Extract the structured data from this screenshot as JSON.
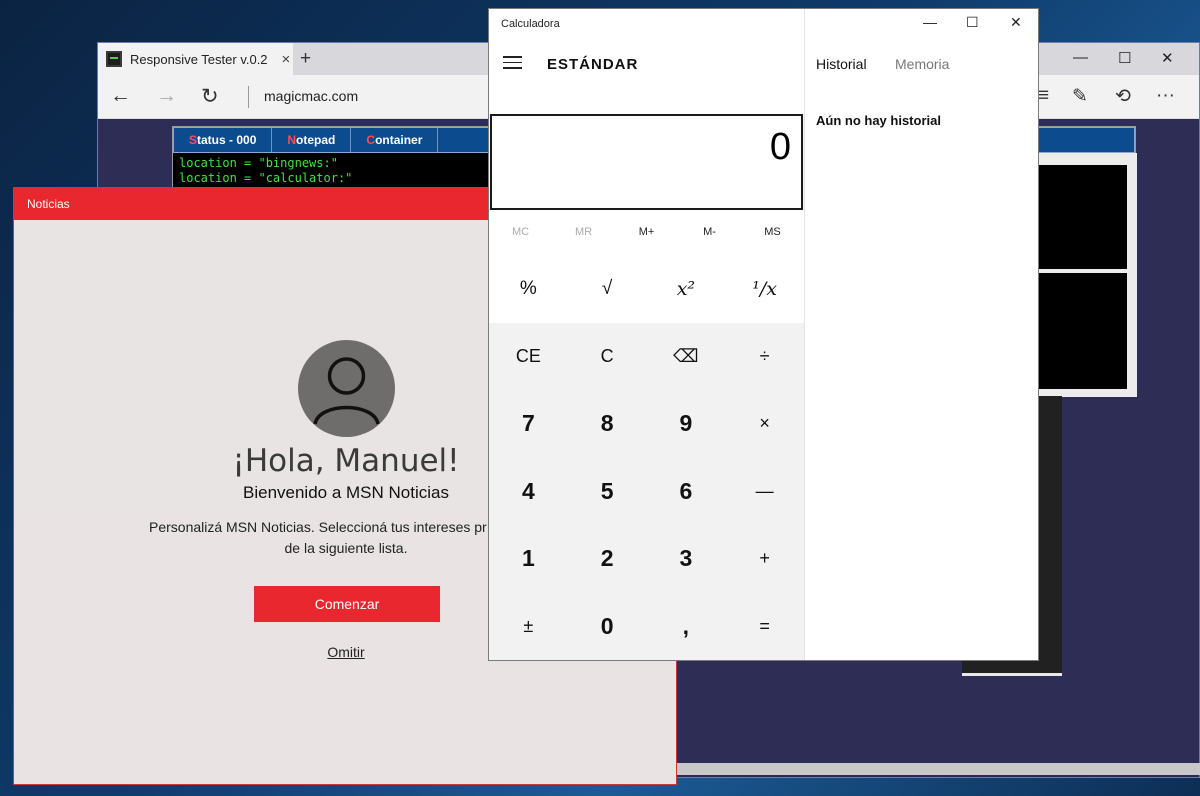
{
  "browser": {
    "tab_title": "Responsive Tester v.0.2",
    "tab_close": "×",
    "new_tab": "+",
    "address": "magicmac.com",
    "window_controls": {
      "minimize": "—",
      "maximize": "☐",
      "close": "✕"
    },
    "nav": {
      "back": "←",
      "forward": "→",
      "refresh": "↻"
    },
    "toolbar": {
      "hub": "≡",
      "note": "✎",
      "share": "⟲",
      "more": "···"
    },
    "tester": {
      "menu": [
        {
          "hot": "S",
          "rest": "tatus - 000"
        },
        {
          "hot": "N",
          "rest": "otepad"
        },
        {
          "hot": "C",
          "rest": "ontainer"
        }
      ],
      "console": [
        "location = \"bingnews:\"",
        "location = \"calculator:\""
      ]
    }
  },
  "news": {
    "window_title": "Noticias",
    "greeting": "¡Hola, Manuel!",
    "welcome": "Bienvenido a MSN Noticias",
    "message_line1": "Personalizá MSN Noticias. Seleccioná tus intereses pr",
    "message_line2": "de la siguiente lista.",
    "start_button": "Comenzar",
    "skip_link": "Omitir"
  },
  "calculator": {
    "window_title": "Calculadora",
    "window_controls": {
      "minimize": "—",
      "maximize": "☐",
      "close": "✕"
    },
    "mode": "ESTÁNDAR",
    "display": "0",
    "memory": {
      "mc": "MC",
      "mr": "MR",
      "mplus": "M+",
      "mminus": "M-",
      "ms": "MS"
    },
    "keys": {
      "percent": "%",
      "sqrt": "√",
      "square": "x²",
      "reciprocal": "¹/x",
      "ce": "CE",
      "c": "C",
      "backspace": "⌫",
      "divide": "÷",
      "seven": "7",
      "eight": "8",
      "nine": "9",
      "multiply": "×",
      "four": "4",
      "five": "5",
      "six": "6",
      "minus": "—",
      "one": "1",
      "two": "2",
      "three": "3",
      "plus": "+",
      "negate": "±",
      "zero": "0",
      "decimal": ",",
      "equals": "="
    },
    "tabs": {
      "history": "Historial",
      "memory": "Memoria"
    },
    "history_empty": "Aún no hay historial"
  }
}
